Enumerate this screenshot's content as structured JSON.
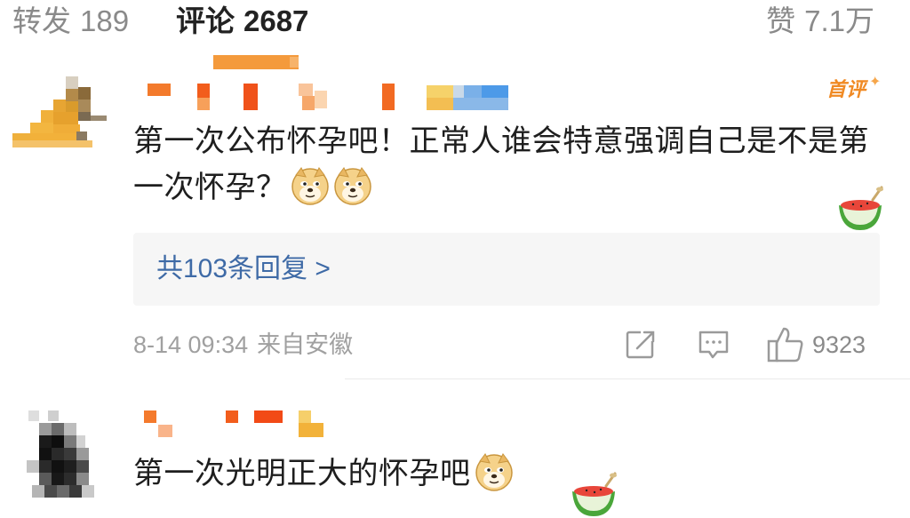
{
  "tabs": {
    "repost_label": "转发",
    "repost_count": "189",
    "comment_label": "评论",
    "comment_count": "2687",
    "like_label": "赞",
    "like_count": "7.1万"
  },
  "comments": [
    {
      "badge": "首评",
      "text": "第一次公布怀孕吧！正常人谁会特意强调自己是不是第一次怀孕？",
      "emojis": [
        "doge-emoji",
        "doge-emoji"
      ],
      "fan_card_icon": "watermelon-icon",
      "replies_link": "共103条回复 >",
      "time": "8-14 09:34",
      "location": "来自安徽",
      "like_count": "9323"
    },
    {
      "text": "第一次光明正大的怀孕吧",
      "emojis": [
        "doge-emoji"
      ],
      "fan_card_icon": "watermelon-icon"
    }
  ],
  "colors": {
    "link": "#3e6aa6",
    "badge": "#f08a24",
    "meta": "#a0a0a0",
    "reply_bg": "#f6f6f6"
  }
}
